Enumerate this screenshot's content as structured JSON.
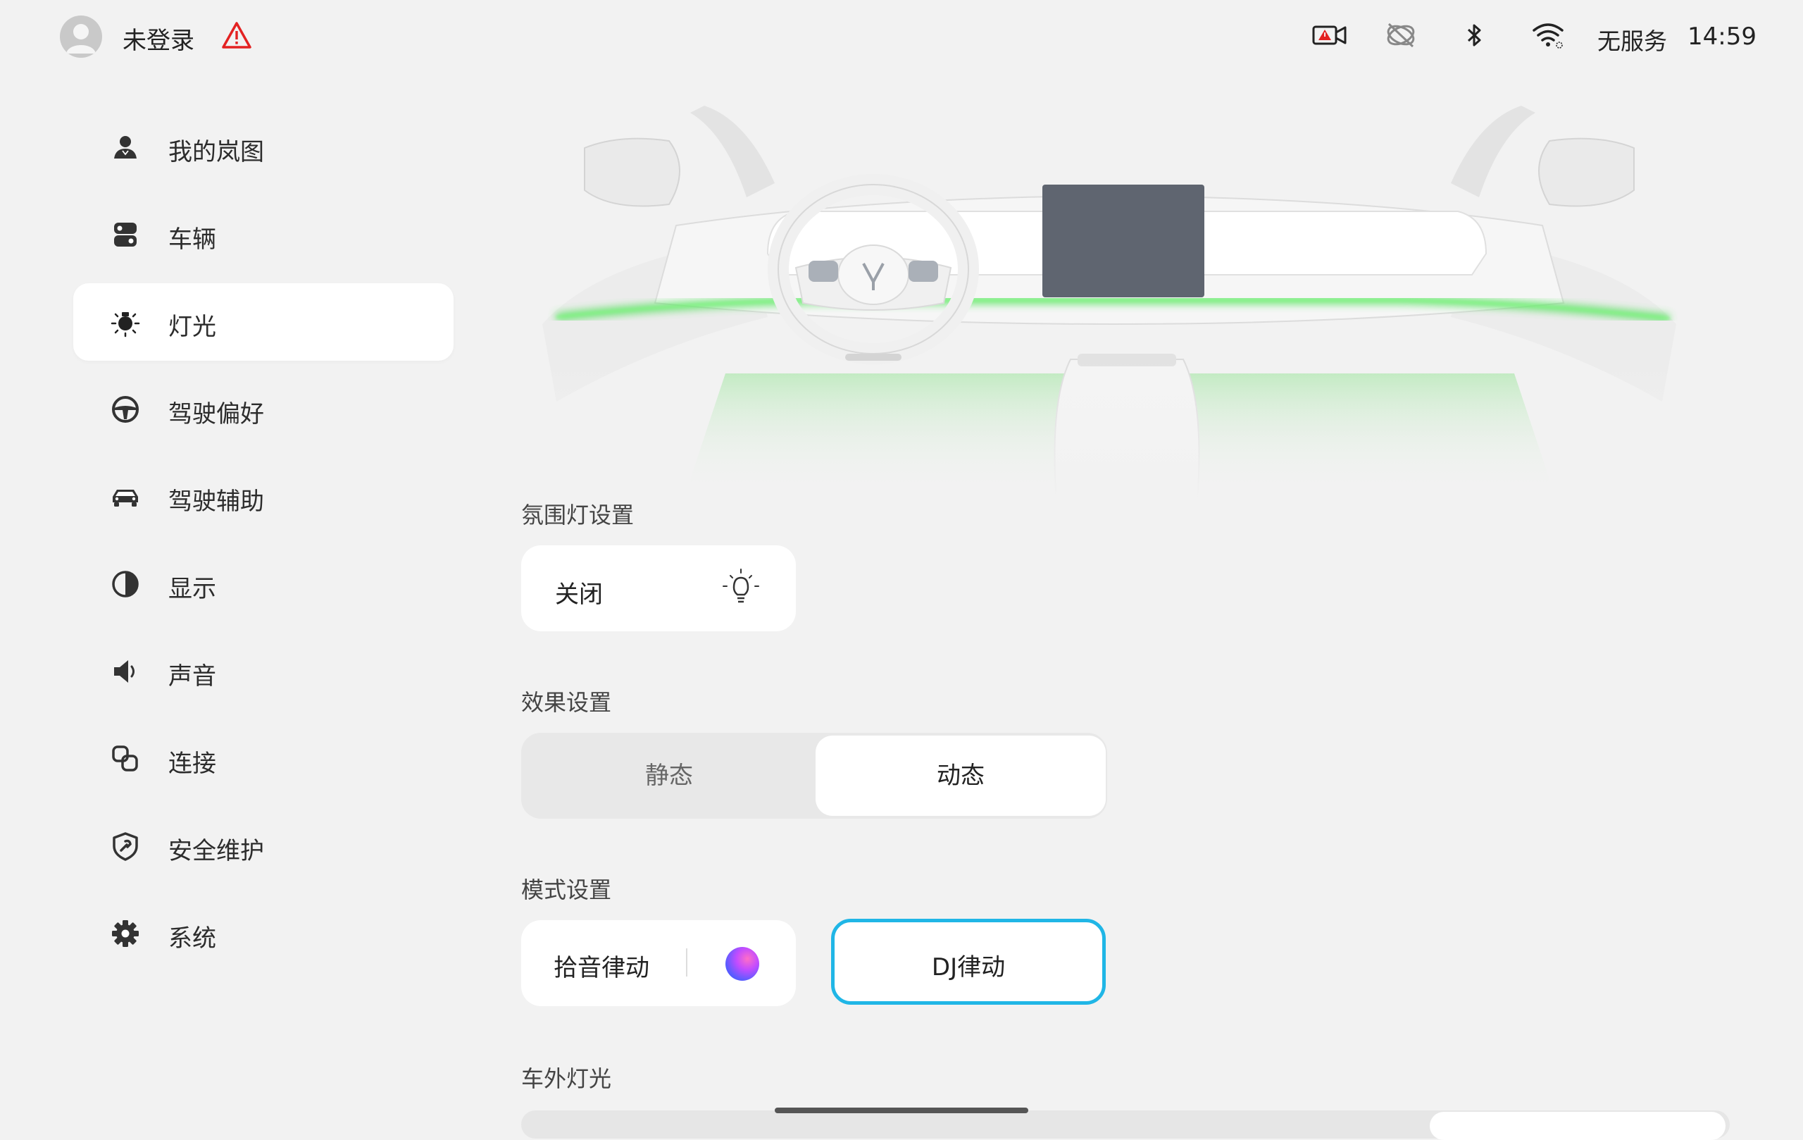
{
  "status_bar": {
    "user_label": "未登录",
    "service_text": "无服务",
    "time": "14:59",
    "icons": [
      "dashcam-alert-icon",
      "network-off-icon",
      "bluetooth-icon",
      "wifi-icon"
    ]
  },
  "sidebar": {
    "items": [
      {
        "label": "我的岚图",
        "icon": "profile-icon"
      },
      {
        "label": "车辆",
        "icon": "vehicle-icon"
      },
      {
        "label": "灯光",
        "icon": "light-icon",
        "active": true
      },
      {
        "label": "驾驶偏好",
        "icon": "steering-wheel-icon"
      },
      {
        "label": "驾驶辅助",
        "icon": "car-assist-icon"
      },
      {
        "label": "显示",
        "icon": "display-icon"
      },
      {
        "label": "声音",
        "icon": "sound-icon"
      },
      {
        "label": "连接",
        "icon": "connect-icon"
      },
      {
        "label": "安全维护",
        "icon": "shield-icon"
      },
      {
        "label": "系统",
        "icon": "gear-icon"
      }
    ]
  },
  "ambient": {
    "title": "氛围灯设置",
    "state_label": "关闭"
  },
  "effect": {
    "title": "效果设置",
    "options": [
      "静态",
      "动态"
    ],
    "selected": "动态"
  },
  "mode": {
    "title": "模式设置",
    "options": [
      "拾音律动",
      "DJ律动"
    ],
    "selected": "DJ律动"
  },
  "exterior": {
    "title": "车外灯光"
  },
  "colors": {
    "accent": "#20b6e6",
    "ambient_glow": "#3fe04a",
    "background": "#f2f2f2"
  }
}
